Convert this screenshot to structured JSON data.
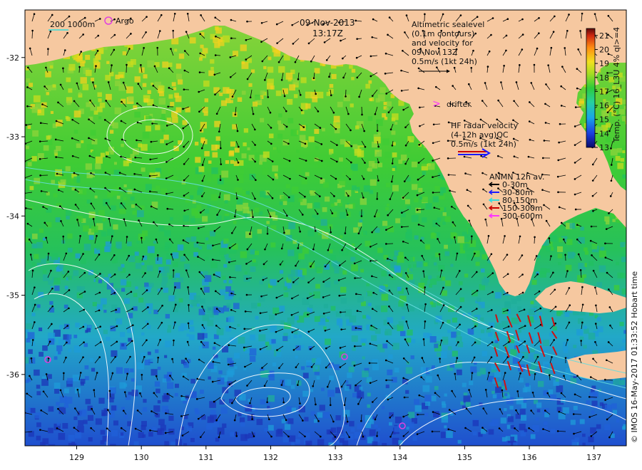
{
  "header": {
    "date": "09-Nov-2013",
    "time": "13:17Z"
  },
  "map_legend": {
    "contour_labels": "200  1000m",
    "argo_label": "Argo",
    "altimetry_lines": [
      "Altimetric sealevel",
      "(0.1m contours)",
      "and velocity for",
      "09-Nov 13Z",
      "0.5m/s (1kt 24h)"
    ],
    "drifter_label": "drifter",
    "hf_radar_lines": [
      "HF radar velocity",
      "(4-12h avg)QC",
      "0.5m/s (1kt 24h)"
    ],
    "anmn_title": "ANMN 12h av.",
    "anmn_depths": [
      {
        "label": "0-30m",
        "color": "#000000"
      },
      {
        "label": "30-80m",
        "color": "#1a1aff"
      },
      {
        "label": "80-150m",
        "color": "#33dddd"
      },
      {
        "label": "150-300m",
        "color": "#cc0000"
      },
      {
        "label": "300-600m",
        "color": "#ff33ff"
      }
    ]
  },
  "colorbar": {
    "title": "Temp. (°C) 16_L3U 4% ql>=4",
    "ticks": [
      "13",
      "14",
      "15",
      "16",
      "17",
      "18",
      "19",
      "20",
      "21"
    ],
    "min": 13,
    "max": 21.5
  },
  "axes": {
    "x_ticks": [
      "129",
      "130",
      "131",
      "132",
      "133",
      "134",
      "135",
      "136",
      "137"
    ],
    "y_ticks": [
      "-32",
      "-33",
      "-34",
      "-35",
      "-36"
    ],
    "lon_range": [
      128.2,
      137.5
    ],
    "lat_range": [
      -31.4,
      -36.9
    ]
  },
  "credit": "© IMOS 16-May-2017 01:33:52 Hobart time",
  "colors": {
    "land": "#f6c8a0",
    "cold": "#1a3fd0",
    "mid": "#2fcf30",
    "warm": "#c8dc1e",
    "hot": "#ffb020"
  }
}
